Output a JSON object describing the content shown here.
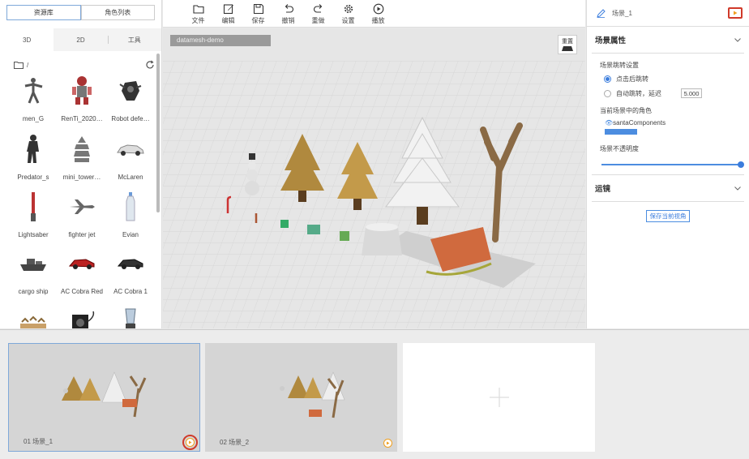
{
  "left_panel": {
    "tabs": [
      "资源库",
      "角色列表"
    ],
    "subtabs": [
      "3D",
      "2D",
      "工具"
    ],
    "path": "/",
    "items": [
      {
        "label": "men_G",
        "icon": "figure-icon"
      },
      {
        "label": "RenTi_2020…",
        "icon": "robot-red-icon"
      },
      {
        "label": "Robot defe…",
        "icon": "robot-dark-icon"
      },
      {
        "label": "Predator_s",
        "icon": "predator-icon"
      },
      {
        "label": "mini_tower…",
        "icon": "tower-icon"
      },
      {
        "label": "McLaren",
        "icon": "car-white-icon"
      },
      {
        "label": "Lightsaber",
        "icon": "lightsaber-icon"
      },
      {
        "label": "fighter jet",
        "icon": "jet-icon"
      },
      {
        "label": "Evian",
        "icon": "bottle-icon"
      },
      {
        "label": "cargo ship",
        "icon": "ship-icon"
      },
      {
        "label": "AC Cobra Red",
        "icon": "car-red-icon"
      },
      {
        "label": "AC Cobra 1",
        "icon": "car-dark-icon"
      },
      {
        "label": "",
        "icon": "deer-icon"
      },
      {
        "label": "",
        "icon": "speaker-icon"
      },
      {
        "label": "",
        "icon": "blender-icon"
      }
    ]
  },
  "toolbar": {
    "items": [
      {
        "label": "文件",
        "icon": "folder-icon"
      },
      {
        "label": "编辑",
        "icon": "edit-icon"
      },
      {
        "label": "保存",
        "icon": "save-icon"
      },
      {
        "label": "撤销",
        "icon": "undo-icon"
      },
      {
        "label": "重做",
        "icon": "redo-icon"
      },
      {
        "label": "设置",
        "icon": "gear-icon"
      },
      {
        "label": "播放",
        "icon": "play-icon"
      }
    ]
  },
  "viewport": {
    "project_name": "datamesh-demo",
    "reset_label": "重置"
  },
  "right_panel": {
    "scene_name": "场景_1",
    "section_scene_props": "场景属性",
    "jump_settings_label": "场景跳转设置",
    "option_click": "点击后跳转",
    "option_auto": "自动跳转，延迟",
    "delay_value": "5.000",
    "characters_label": "当前场景中的角色",
    "character_name": "santaComponents",
    "opacity_label": "场景不透明度",
    "opacity_value": 1.0,
    "section_camera": "运镜",
    "save_view_label": "保存当前视角"
  },
  "timeline": {
    "scenes": [
      {
        "label": "01 场景_1",
        "selected": true
      },
      {
        "label": "02 场景_2",
        "selected": false
      }
    ]
  },
  "colors": {
    "accent": "#3b7ddd",
    "highlight_red": "#d03a2a",
    "play_orange": "#f0a020"
  }
}
